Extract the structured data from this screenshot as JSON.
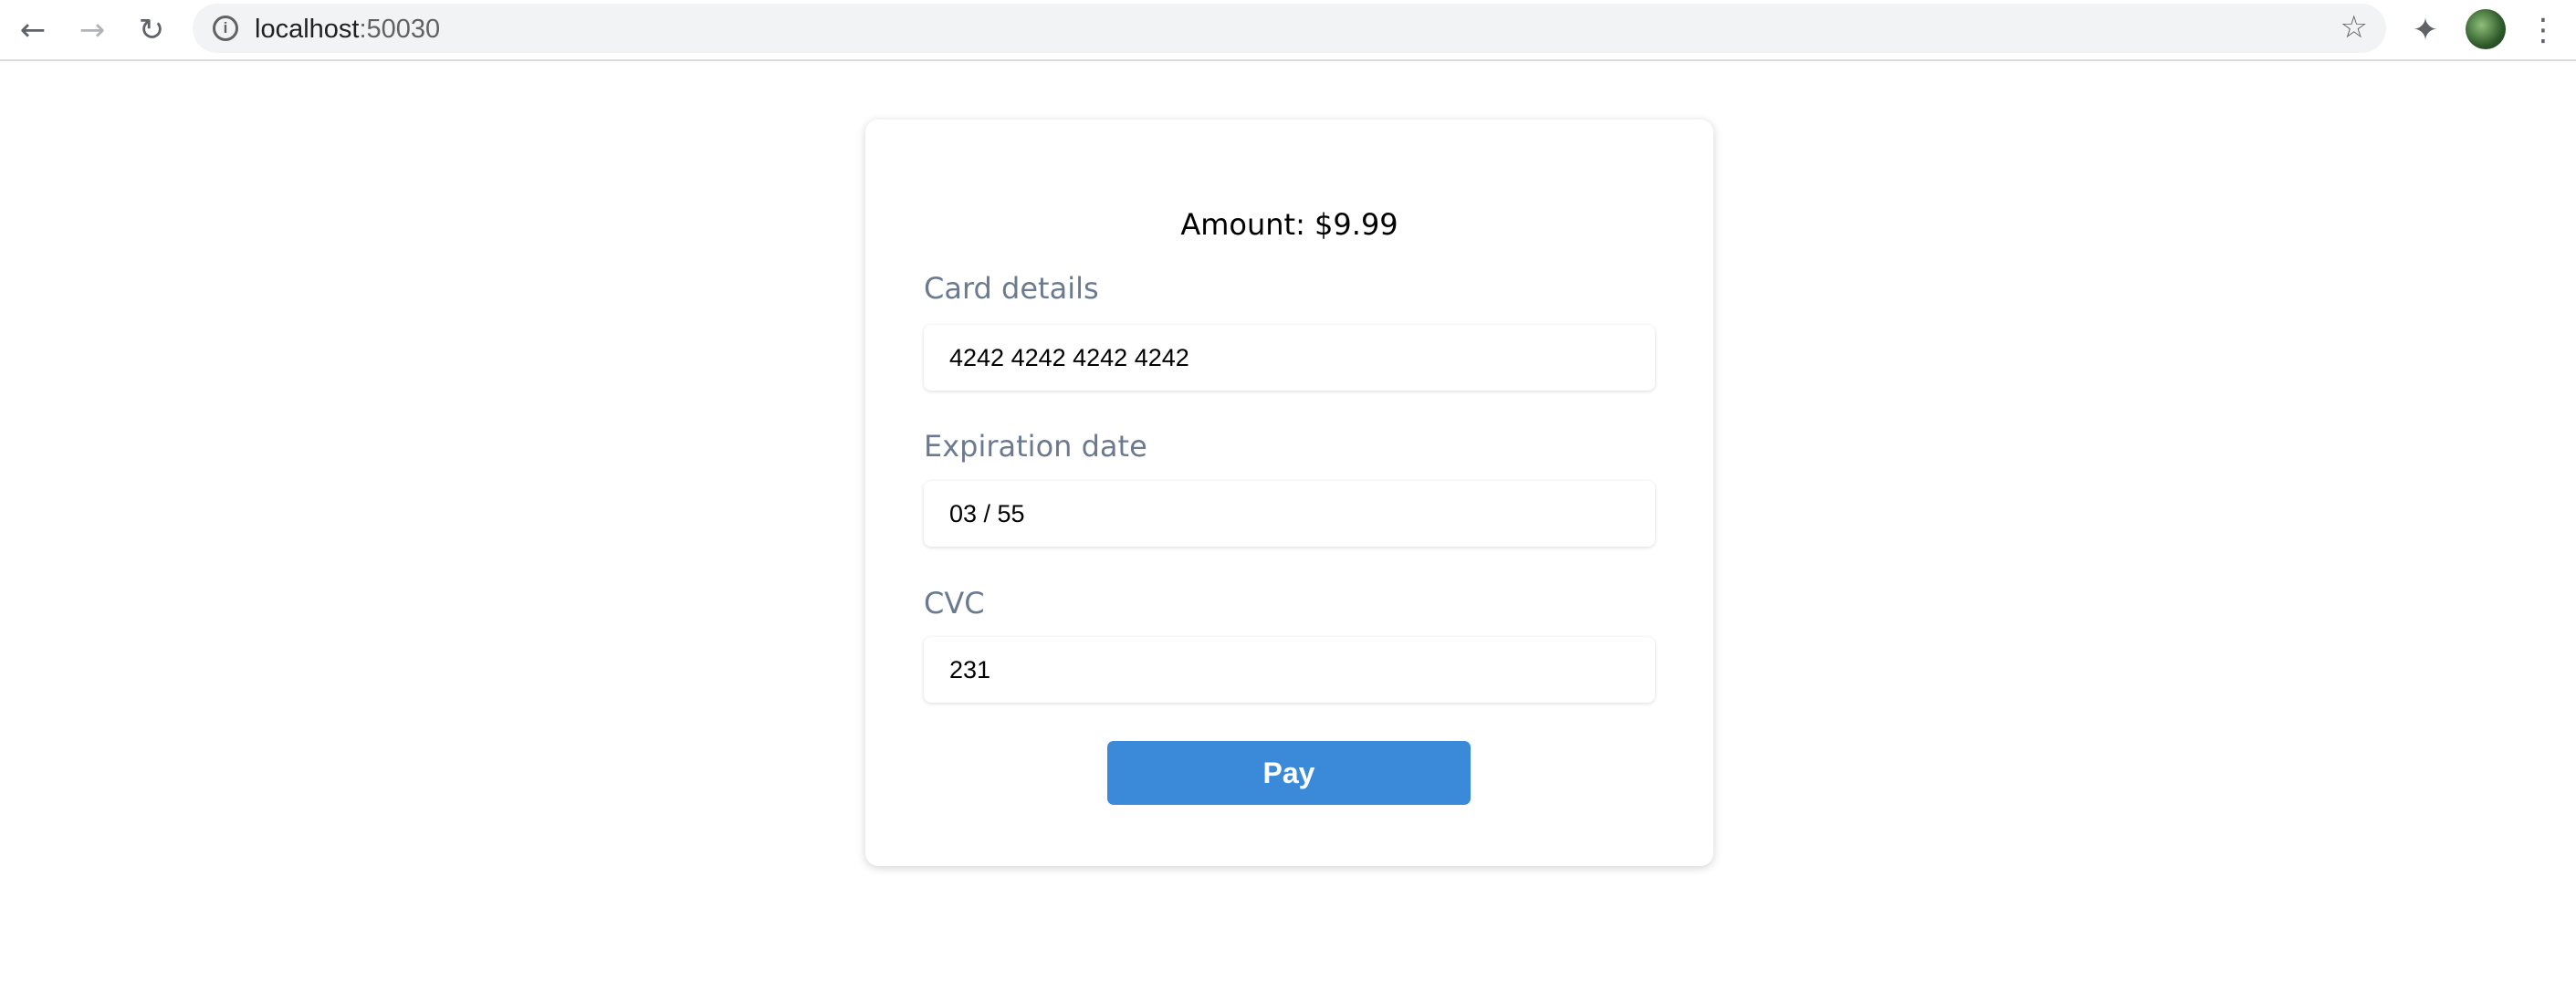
{
  "browser": {
    "url_host": "localhost",
    "url_port": ":50030"
  },
  "payment": {
    "amount": "Amount: $9.99",
    "card_label": "Card details",
    "card_value": "4242 4242 4242 4242",
    "exp_label": "Expiration date",
    "exp_value": "03 / 55",
    "cvc_label": "CVC",
    "cvc_value": "231",
    "pay_label": "Pay"
  },
  "colors": {
    "accent": "#3a8ad9",
    "label": "#6b7a90"
  }
}
